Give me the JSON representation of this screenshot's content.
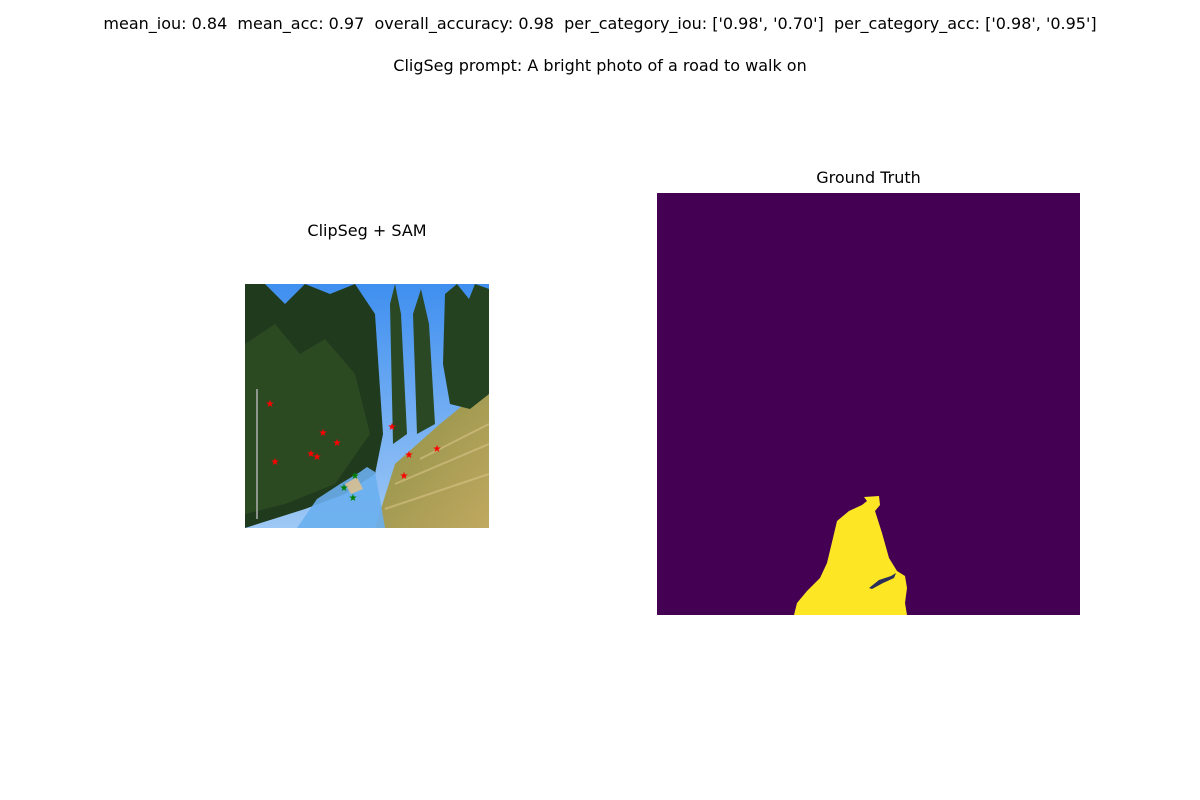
{
  "header": {
    "metrics": "mean_iou: 0.84  mean_acc: 0.97  overall_accuracy: 0.98  per_category_iou: ['0.98', '0.70']  per_category_acc: ['0.98', '0.95']",
    "prompt": "CligSeg prompt: A bright photo of a road to walk on"
  },
  "panels": {
    "left_title": "ClipSeg + SAM",
    "right_title": "Ground Truth"
  },
  "colors": {
    "mask_background": "#440154",
    "mask_foreground": "#fde725",
    "predicted_overlay": "#6aaff0",
    "negative_point": "#ff0000",
    "positive_point": "#008000"
  }
}
